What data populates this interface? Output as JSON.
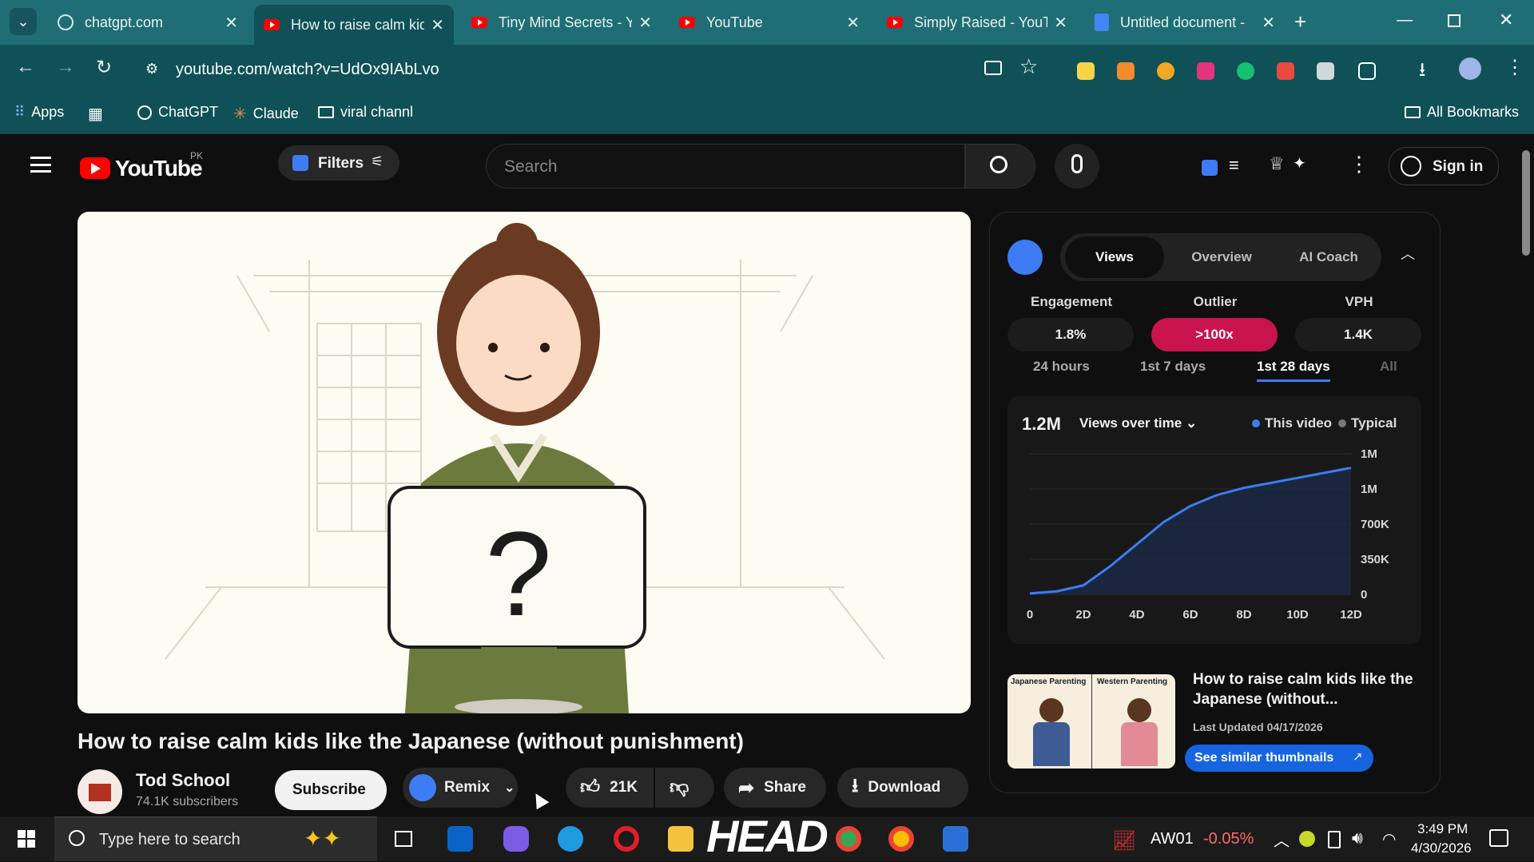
{
  "browser": {
    "tabs": [
      {
        "label": "chatgpt.com"
      },
      {
        "label": "How to raise calm kid"
      },
      {
        "label": "Tiny Mind Secrets - Y"
      },
      {
        "label": "YouTube"
      },
      {
        "label": "Simply Raised - YouT"
      },
      {
        "label": "Untitled document -"
      }
    ],
    "url": "youtube.com/watch?v=UdOx9IAbLvo",
    "bookmarks": {
      "apps": "Apps",
      "chatgpt": "ChatGPT",
      "claude": "Claude",
      "folder": "viral channl",
      "all": "All Bookmarks"
    }
  },
  "youtube": {
    "logo_text": "YouTube",
    "region": "PK",
    "filters_label": "Filters",
    "search_placeholder": "Search",
    "sign_in": "Sign in"
  },
  "video": {
    "title": "How to raise calm kids like the Japanese (without punishment)",
    "channel": "Tod School",
    "subscribers": "74.1K subscribers",
    "subscribe": "Subscribe",
    "remix": "Remix",
    "likes": "21K",
    "share": "Share",
    "download": "Download",
    "thumbnail_symbol": "?"
  },
  "panel": {
    "tabs": [
      "Views",
      "Overview",
      "AI Coach"
    ],
    "active_tab": "Views",
    "metrics": [
      {
        "label": "Engagement",
        "value": "1.8%"
      },
      {
        "label": "Outlier",
        "value": ">100x"
      },
      {
        "label": "VPH",
        "value": "1.4K"
      }
    ],
    "ranges": [
      "24 hours",
      "1st 7 days",
      "1st 28 days",
      "All"
    ],
    "active_range": "1st 28 days",
    "total_views": "1.2M",
    "chart_selector": "Views over time",
    "legend": [
      "This video",
      "Typical"
    ],
    "similar": {
      "title": "How to raise calm kids like the Japanese (without...",
      "updated": "Last Updated 04/17/2026",
      "button": "See similar thumbnails",
      "thumb_left": "Japanese Parenting",
      "thumb_right": "Western Parenting"
    },
    "colors": {
      "accent": "#3d7cf4",
      "outlier": "#c8134f",
      "brand": "#ff0000"
    }
  },
  "chart_data": {
    "type": "area",
    "x": [
      0,
      1,
      2,
      3,
      4,
      5,
      6,
      7,
      8,
      9,
      10,
      11,
      12
    ],
    "series": [
      {
        "name": "This video",
        "values": [
          10000,
          30000,
          90000,
          280000,
          500000,
          720000,
          880000,
          990000,
          1060000,
          1110000,
          1160000,
          1210000,
          1260000
        ]
      }
    ],
    "xticks": [
      "0",
      "2D",
      "4D",
      "6D",
      "8D",
      "10D",
      "12D"
    ],
    "yticks": [
      "0",
      "350K",
      "700K",
      "1M",
      "1M"
    ],
    "ylim": [
      0,
      1400000
    ],
    "grid": true
  },
  "taskbar": {
    "search_placeholder": "Type here to search",
    "widget_text": "HEAD",
    "ticker": "AW01",
    "ticker_change": "-0.05%",
    "time": "3:49 PM",
    "date": "4/30/2026"
  }
}
